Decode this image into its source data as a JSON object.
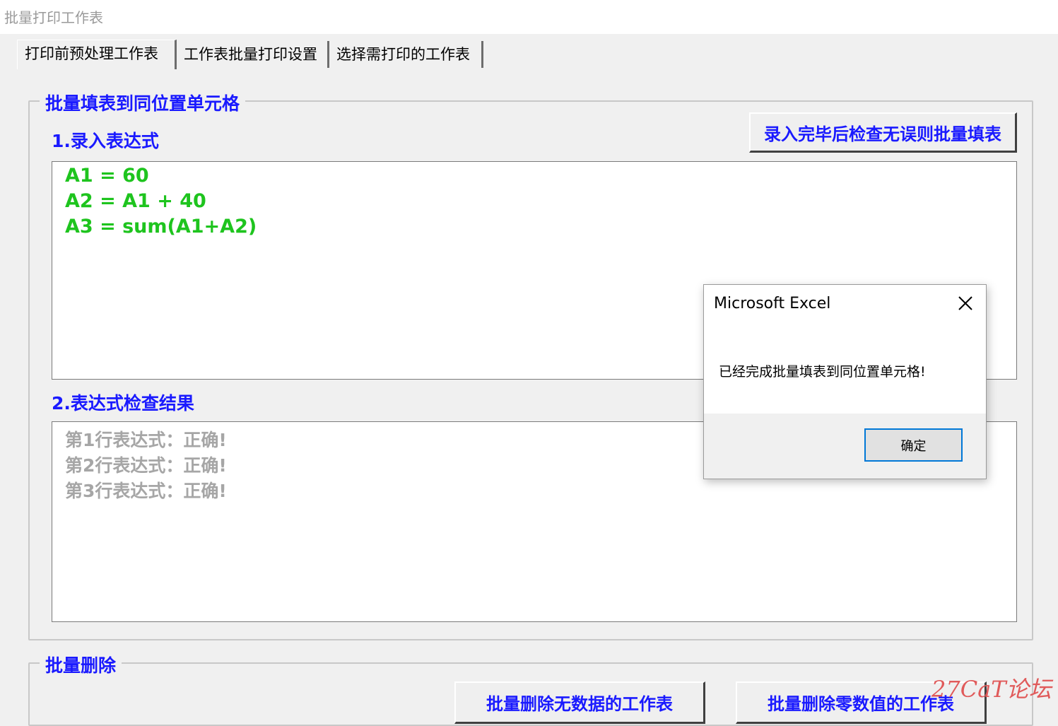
{
  "window": {
    "title": "批量打印工作表"
  },
  "tabs": [
    {
      "label": "打印前预处理工作表",
      "active": true
    },
    {
      "label": "工作表批量打印设置",
      "active": false
    },
    {
      "label": "选择需打印的工作表",
      "active": false
    }
  ],
  "group_fill": {
    "legend": "批量填表到同位置单元格",
    "expr_label": "1.录入表达式",
    "fill_button": "录入完毕后检查无误则批量填表",
    "expressions": [
      "A1 = 60",
      "A2 = A1 + 40",
      "A3 = sum(A1+A2)"
    ],
    "check_label": "2.表达式检查结果",
    "results": [
      "第1行表达式：正确!",
      "第2行表达式：正确!",
      "第3行表达式：正确!"
    ]
  },
  "group_delete": {
    "legend": "批量删除",
    "btn_empty": "批量删除无数据的工作表",
    "btn_zero": "批量删除零数值的工作表"
  },
  "dialog": {
    "title": "Microsoft Excel",
    "message": "已经完成批量填表到同位置单元格!",
    "ok": "确定"
  },
  "watermark": "27CaT论坛",
  "colors": {
    "accent_blue": "#1a1aff",
    "expr_green": "#1ec41e",
    "result_gray": "#a6a6a6",
    "dialog_focus": "#0078d7"
  }
}
